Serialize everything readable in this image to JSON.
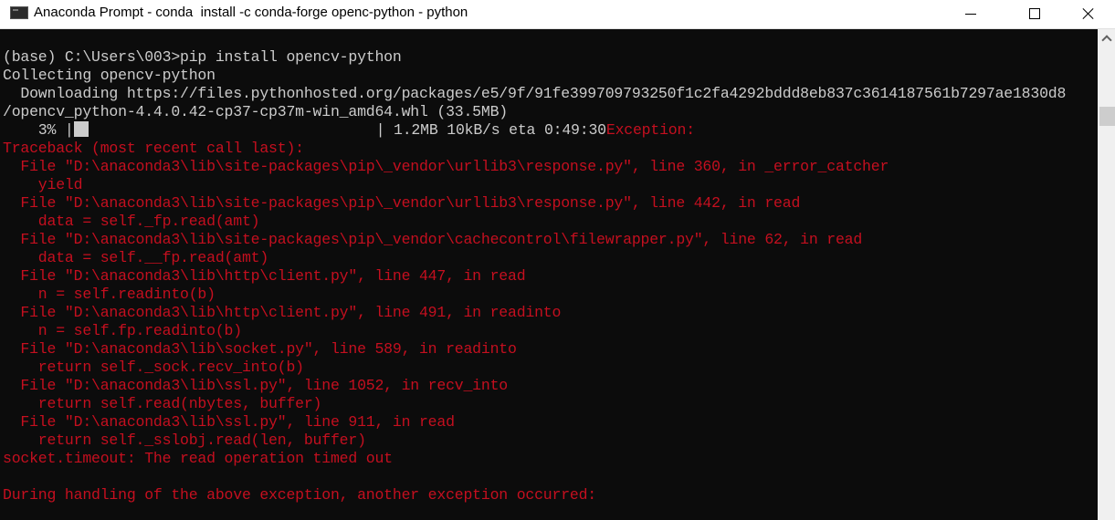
{
  "window": {
    "title": "Anaconda Prompt - conda  install -c conda-forge openc-python - python",
    "icon": "terminal-icon",
    "controls": {
      "minimize": "minimize-icon",
      "maximize": "maximize-icon",
      "close": "close-icon"
    }
  },
  "colors": {
    "background": "#0c0c0c",
    "text": "#cccccc",
    "error": "#c50f1f",
    "titlebar": "#ffffff",
    "scrollbar": "#f0f0f0"
  },
  "terminal": {
    "prompt": "(base) C:\\Users\\003>pip install opencv-python",
    "collecting": "Collecting opencv-python",
    "downloading": "  Downloading https://files.pythonhosted.org/packages/e5/9f/91fe399709793250f1c2fa4292bddd8eb837c3614187561b7297ae1830d8",
    "wheel": "/opencv_python-4.4.0.42-cp37-cp37m-win_amd64.whl (33.5MB)",
    "progress": {
      "percent_label": "    3% |",
      "percent": 3,
      "stats": "| 1.2MB 10kB/s eta 0:49:30",
      "exception": "Exception:"
    },
    "traceback": [
      "Traceback (most recent call last):",
      "  File \"D:\\anaconda3\\lib\\site-packages\\pip\\_vendor\\urllib3\\response.py\", line 360, in _error_catcher",
      "    yield",
      "  File \"D:\\anaconda3\\lib\\site-packages\\pip\\_vendor\\urllib3\\response.py\", line 442, in read",
      "    data = self._fp.read(amt)",
      "  File \"D:\\anaconda3\\lib\\site-packages\\pip\\_vendor\\cachecontrol\\filewrapper.py\", line 62, in read",
      "    data = self.__fp.read(amt)",
      "  File \"D:\\anaconda3\\lib\\http\\client.py\", line 447, in read",
      "    n = self.readinto(b)",
      "  File \"D:\\anaconda3\\lib\\http\\client.py\", line 491, in readinto",
      "    n = self.fp.readinto(b)",
      "  File \"D:\\anaconda3\\lib\\socket.py\", line 589, in readinto",
      "    return self._sock.recv_into(b)",
      "  File \"D:\\anaconda3\\lib\\ssl.py\", line 1052, in recv_into",
      "    return self.read(nbytes, buffer)",
      "  File \"D:\\anaconda3\\lib\\ssl.py\", line 911, in read",
      "    return self._sslobj.read(len, buffer)",
      "socket.timeout: The read operation timed out",
      "",
      "During handling of the above exception, another exception occurred:"
    ]
  },
  "scrollbar": {
    "up_icon": "chevron-up-icon"
  }
}
